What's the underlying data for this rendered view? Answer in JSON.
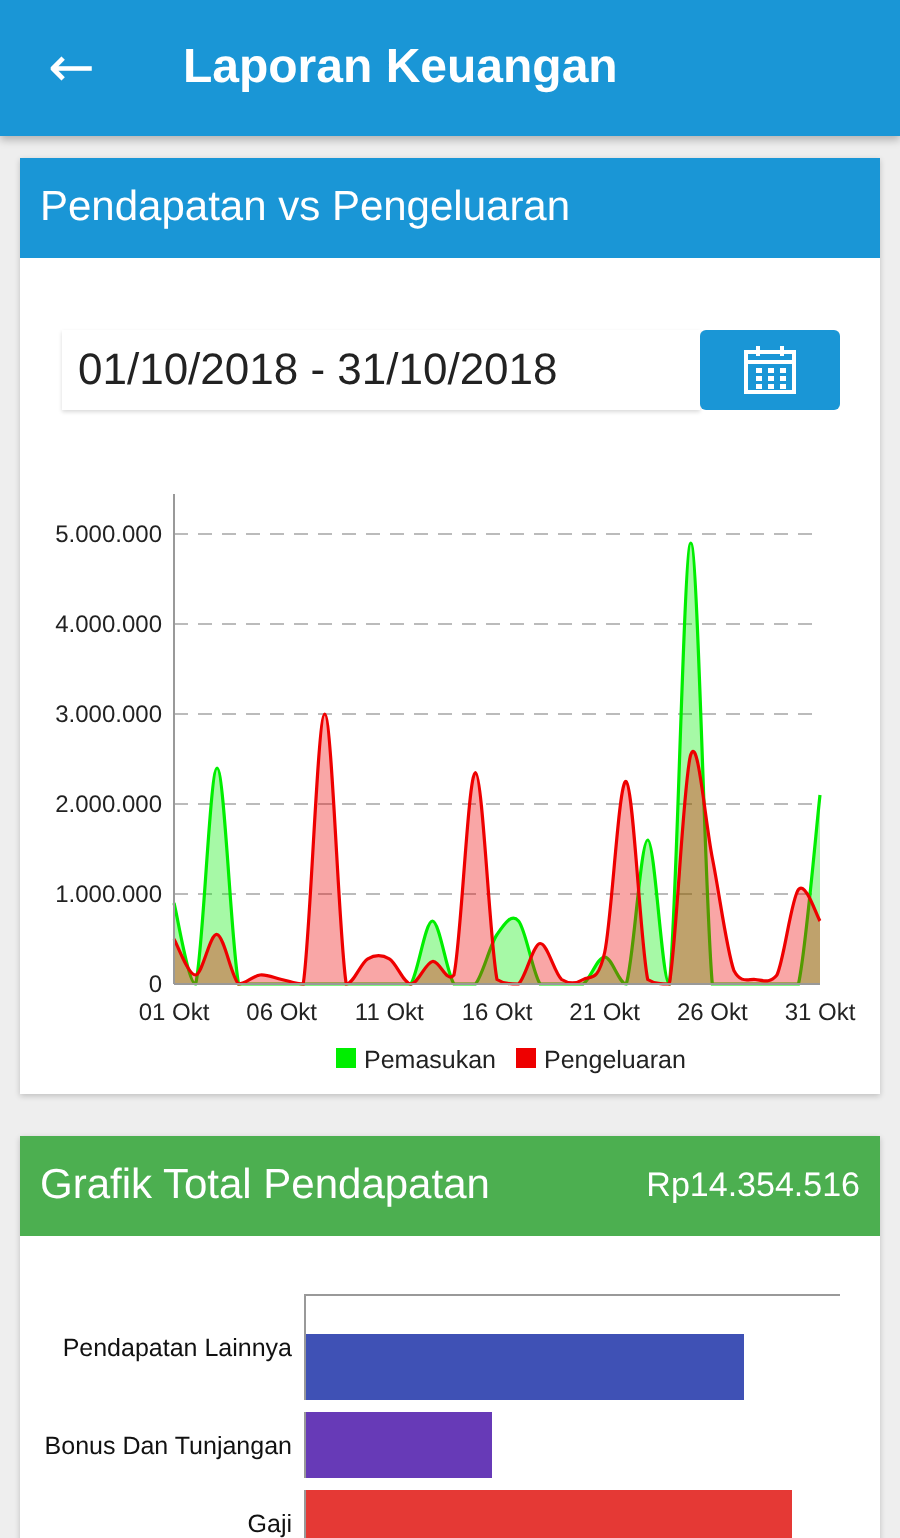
{
  "app_bar": {
    "back": "←",
    "title": "Laporan Keuangan"
  },
  "income_expense_card": {
    "title": "Pendapatan vs Pengeluaran",
    "date_range": "01/10/2018 - 31/10/2018",
    "chart_data": {
      "type": "area",
      "x": [
        1,
        2,
        3,
        4,
        5,
        6,
        7,
        8,
        9,
        10,
        11,
        12,
        13,
        14,
        15,
        16,
        17,
        18,
        19,
        20,
        21,
        22,
        23,
        24,
        25,
        26,
        27,
        28,
        29,
        30,
        31
      ],
      "xticks": [
        {
          "value": 1,
          "label": "01 Okt"
        },
        {
          "value": 6,
          "label": "06 Okt"
        },
        {
          "value": 11,
          "label": "11 Okt"
        },
        {
          "value": 16,
          "label": "16 Okt"
        },
        {
          "value": 21,
          "label": "21 Okt"
        },
        {
          "value": 26,
          "label": "26 Okt"
        },
        {
          "value": 31,
          "label": "31 Okt"
        }
      ],
      "yticks": [
        {
          "value": 0,
          "label": "0"
        },
        {
          "value": 1000000,
          "label": "1.000.000"
        },
        {
          "value": 2000000,
          "label": "2.000.000"
        },
        {
          "value": 3000000,
          "label": "3.000.000"
        },
        {
          "value": 4000000,
          "label": "4.000.000"
        },
        {
          "value": 5000000,
          "label": "5.000.000"
        }
      ],
      "ylim": [
        0,
        5000000
      ],
      "xlim": [
        1,
        31
      ],
      "grid": "y",
      "legend": true,
      "series": [
        {
          "name": "Pemasukan",
          "color": "#00ee00",
          "values": [
            900000,
            0,
            2400000,
            0,
            0,
            0,
            0,
            0,
            0,
            0,
            0,
            0,
            700000,
            0,
            0,
            550000,
            700000,
            0,
            0,
            0,
            300000,
            0,
            1600000,
            0,
            4900000,
            0,
            0,
            0,
            0,
            0,
            2100000
          ]
        },
        {
          "name": "Pengeluaran",
          "color": "#ee0000",
          "values": [
            500000,
            100000,
            550000,
            0,
            100000,
            50000,
            0,
            3000000,
            0,
            280000,
            280000,
            0,
            250000,
            100000,
            2350000,
            50000,
            0,
            450000,
            50000,
            50000,
            350000,
            2250000,
            50000,
            0,
            2550000,
            1400000,
            150000,
            50000,
            100000,
            1050000,
            700000
          ]
        }
      ]
    }
  },
  "income_total_card": {
    "title": "Grafik Total Pendapatan",
    "total": "Rp14.354.516",
    "bars": [
      {
        "label": "Pendapatan Lainnya",
        "level": 0.82,
        "color": "#3f51b5"
      },
      {
        "label": "Bonus Dan Tunjangan",
        "level": 0.35,
        "color": "#673ab7"
      },
      {
        "label": "Gaji",
        "level": 0.91,
        "color": "#e53935"
      }
    ]
  }
}
